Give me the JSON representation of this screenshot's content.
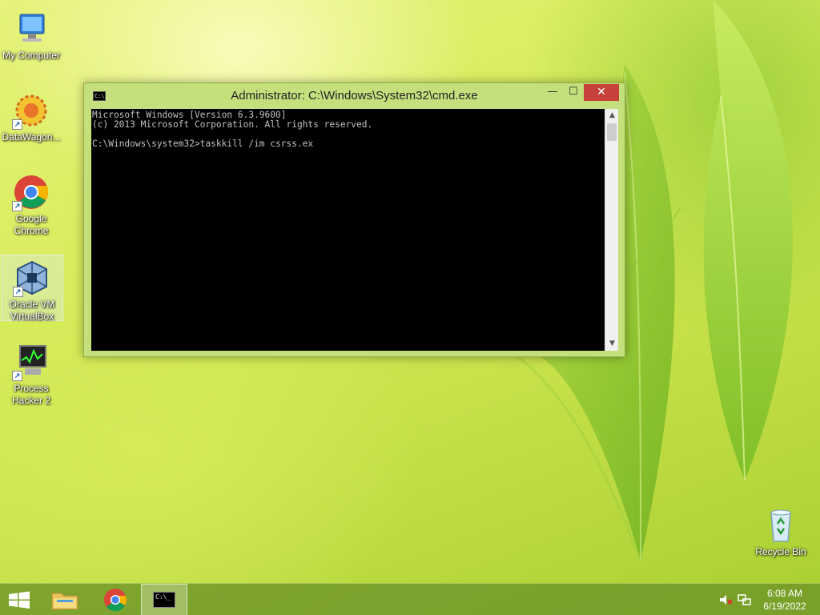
{
  "desktop": {
    "icons": [
      {
        "label": "My Computer"
      },
      {
        "label": "DataWagon..."
      },
      {
        "label": "Google Chrome"
      },
      {
        "label": "Oracle VM VirtualBox"
      },
      {
        "label": "Process Hacker 2"
      },
      {
        "label": "Recycle Bin"
      }
    ]
  },
  "cmd_window": {
    "title": "Administrator: C:\\Windows\\System32\\cmd.exe",
    "icon_glyph": "C:\\_",
    "minimize_glyph": "—",
    "maximize_glyph": "☐",
    "close_glyph": "✕",
    "lines": [
      "Microsoft Windows [Version 6.3.9600]",
      "(c) 2013 Microsoft Corporation. All rights reserved.",
      "",
      "C:\\Windows\\system32>taskkill /im csrss.ex"
    ]
  },
  "taskbar": {
    "cmd_glyph": "C:\\_",
    "clock_time": "6:08 AM",
    "clock_date": "6/19/2022"
  },
  "colors": {
    "close_button": "#c7423b",
    "console_bg": "#000000",
    "console_text": "#c0c0c0",
    "window_frame": "#c4e07c"
  }
}
